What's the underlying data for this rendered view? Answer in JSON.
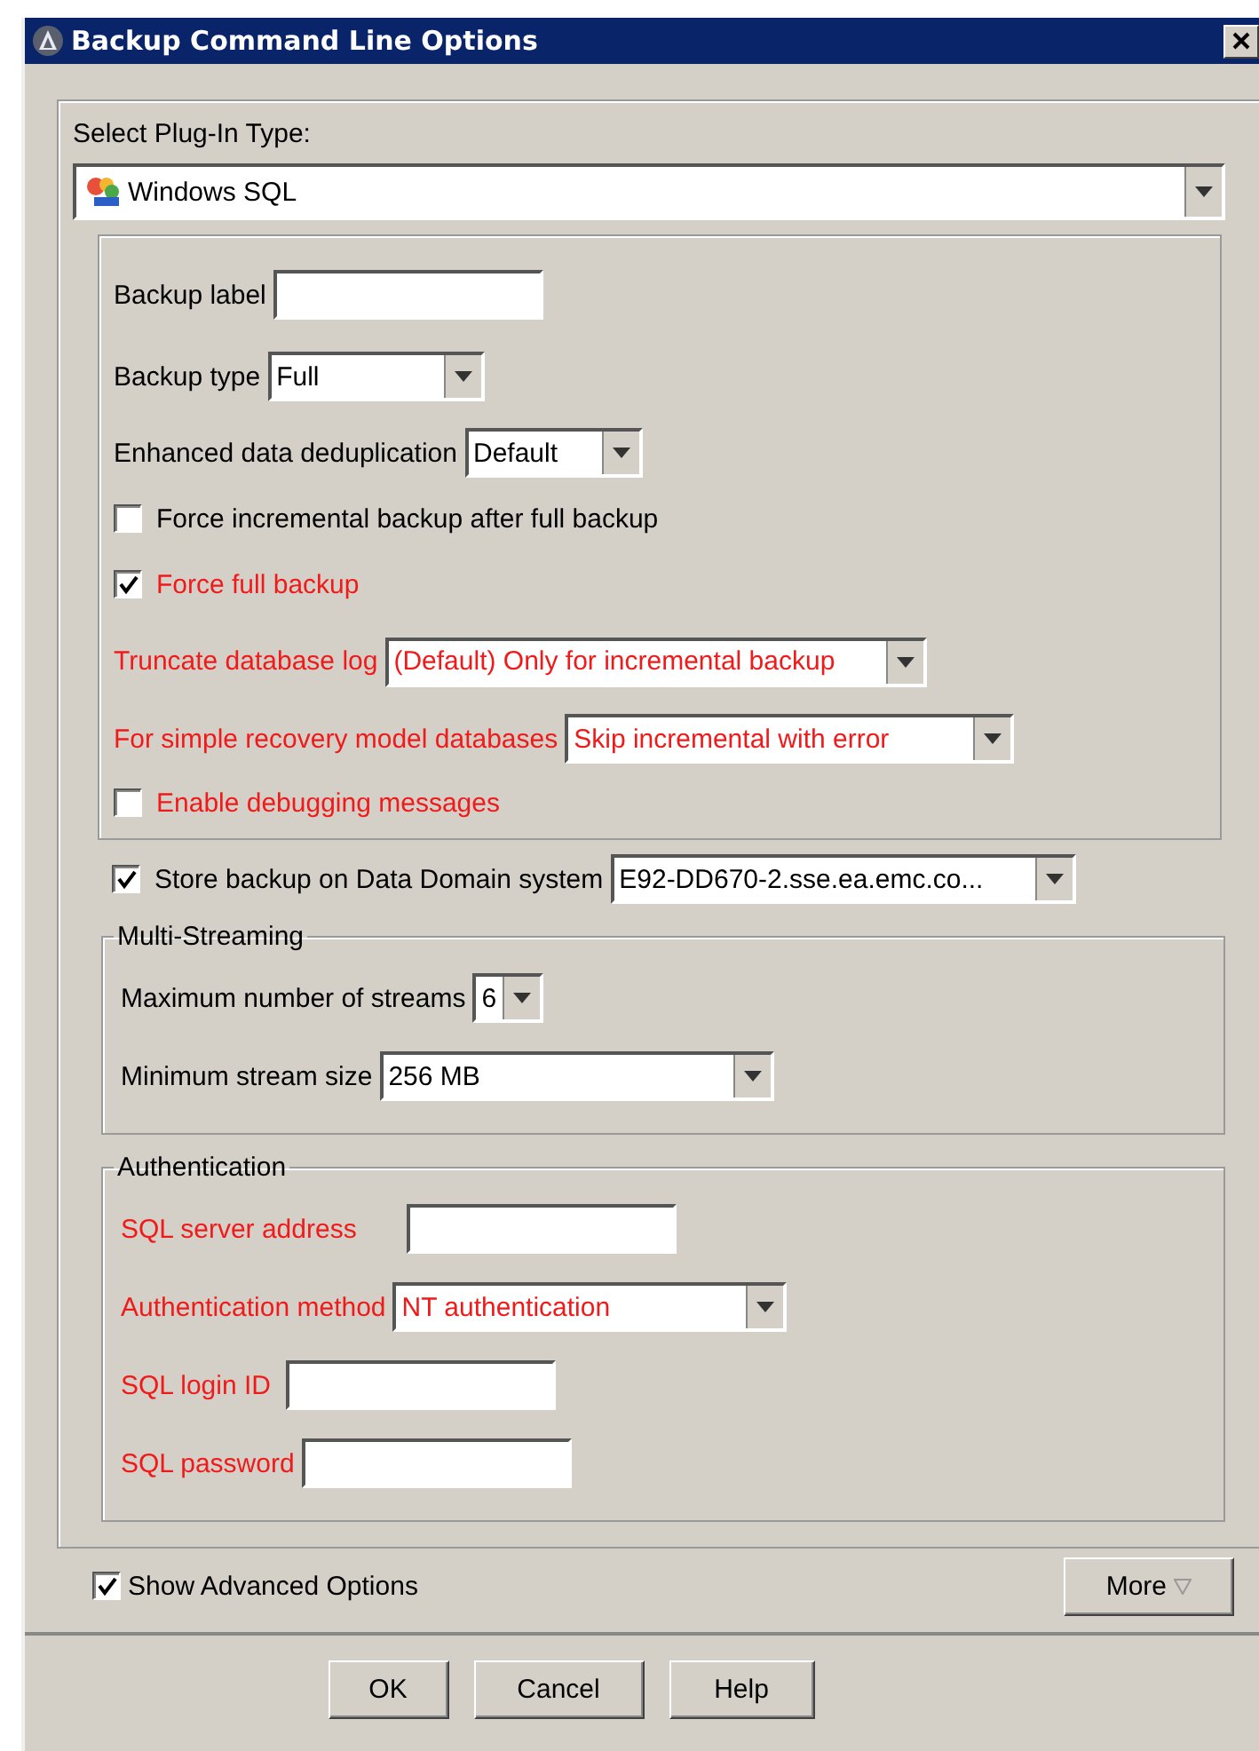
{
  "window": {
    "title": "Backup Command Line Options"
  },
  "plugin": {
    "label": "Select Plug-In Type:",
    "value": "Windows SQL"
  },
  "options": [
    {
      "kind": "text",
      "label": "Backup label",
      "highlighted": false
    },
    {
      "kind": "combo",
      "label": "Backup type",
      "value": "Full",
      "highlighted": false
    },
    {
      "kind": "combo",
      "label": "Enhanced data deduplication",
      "value": "Default",
      "highlighted": false
    },
    {
      "kind": "checkbox",
      "label": "Force incremental backup after full backup",
      "checked": false,
      "highlighted": false
    },
    {
      "kind": "checkbox",
      "label": "Force full backup",
      "checked": true,
      "highlighted": true
    },
    {
      "kind": "combo",
      "label": "Truncate database log",
      "value": "(Default) Only for incremental backup",
      "highlighted": true
    },
    {
      "kind": "combo",
      "label": "For simple recovery model databases",
      "value": "Skip incremental with error",
      "highlighted": true
    },
    {
      "kind": "checkbox",
      "label": "Enable debugging messages",
      "checked": false,
      "highlighted": true
    }
  ],
  "data_domain": {
    "label": "Store backup on Data Domain system",
    "checked": true,
    "value": "E92-DD670-2.sse.ea.emc.co..."
  },
  "groups": [
    {
      "title": "Multi-Streaming",
      "fields": [
        {
          "kind": "combo",
          "label": "Maximum number of streams",
          "value": "6",
          "highlighted": false
        },
        {
          "kind": "combo",
          "label": "Minimum stream size",
          "value": "256 MB",
          "highlighted": false
        }
      ]
    },
    {
      "title": "Authentication",
      "fields": [
        {
          "kind": "text",
          "label": "SQL server address",
          "highlighted": true
        },
        {
          "kind": "combo",
          "label": "Authentication method",
          "value": "NT authentication",
          "highlighted": true
        },
        {
          "kind": "text",
          "label": "SQL login ID",
          "highlighted": true
        },
        {
          "kind": "text",
          "label": "SQL password",
          "highlighted": true
        }
      ]
    }
  ],
  "advanced": {
    "label": "Show Advanced Options",
    "checked": true
  },
  "more_button": "More",
  "buttons": [
    "OK",
    "Cancel",
    "Help"
  ]
}
